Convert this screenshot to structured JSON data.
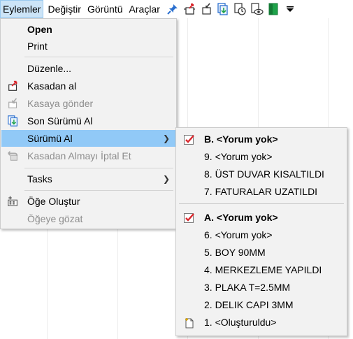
{
  "menubar": {
    "items": [
      "Eylemler",
      "Değiştir",
      "Görüntü",
      "Araçlar"
    ],
    "toolbar_icons": [
      "pin-icon",
      "checkout-icon",
      "checkin-icon",
      "latest-version-icon",
      "version-history-icon",
      "view-icon",
      "exit-icon",
      "more-dropdown-icon"
    ]
  },
  "main_menu": {
    "items": [
      {
        "label": "Open",
        "bold": true
      },
      {
        "label": "Print"
      },
      {
        "label": "Düzenle..."
      },
      {
        "label": "Kasadan al"
      },
      {
        "label": "Kasaya gönder",
        "disabled": true
      },
      {
        "label": "Son Sürümü Al"
      },
      {
        "label": "Sürümü Al",
        "highlighted": true
      },
      {
        "label": "Kasadan Almayı İptal Et",
        "disabled": true
      },
      {
        "label": "Tasks"
      },
      {
        "label": "Öğe Oluştur"
      },
      {
        "label": "Öğeye gözat",
        "disabled": true
      }
    ]
  },
  "sub_menu": {
    "group_b": [
      {
        "label": "B. <Yorum yok>",
        "bold": true,
        "checked": true
      },
      {
        "label": "9. <Yorum yok>"
      },
      {
        "label": "8. ÜST DUVAR KISALTILDI"
      },
      {
        "label": "7. FATURALAR UZATILDI"
      }
    ],
    "group_a": [
      {
        "label": "A. <Yorum yok>",
        "bold": true,
        "checked": true
      },
      {
        "label": "6. <Yorum yok>"
      },
      {
        "label": "5. BOY 90MM"
      },
      {
        "label": "4. MERKEZLEME YAPILDI"
      },
      {
        "label": "3. PLAKA T=2.5MM"
      },
      {
        "label": "2. DELIK CAPI 3MM"
      },
      {
        "label": "1. <Oluşturuldu>"
      }
    ]
  },
  "colors": {
    "highlight": "#91c9f7",
    "menu_bg": "#f2f2f2",
    "disabled_text": "#8d8d8d",
    "check_red": "#d9262c",
    "exit_green": "#1ea24a"
  }
}
